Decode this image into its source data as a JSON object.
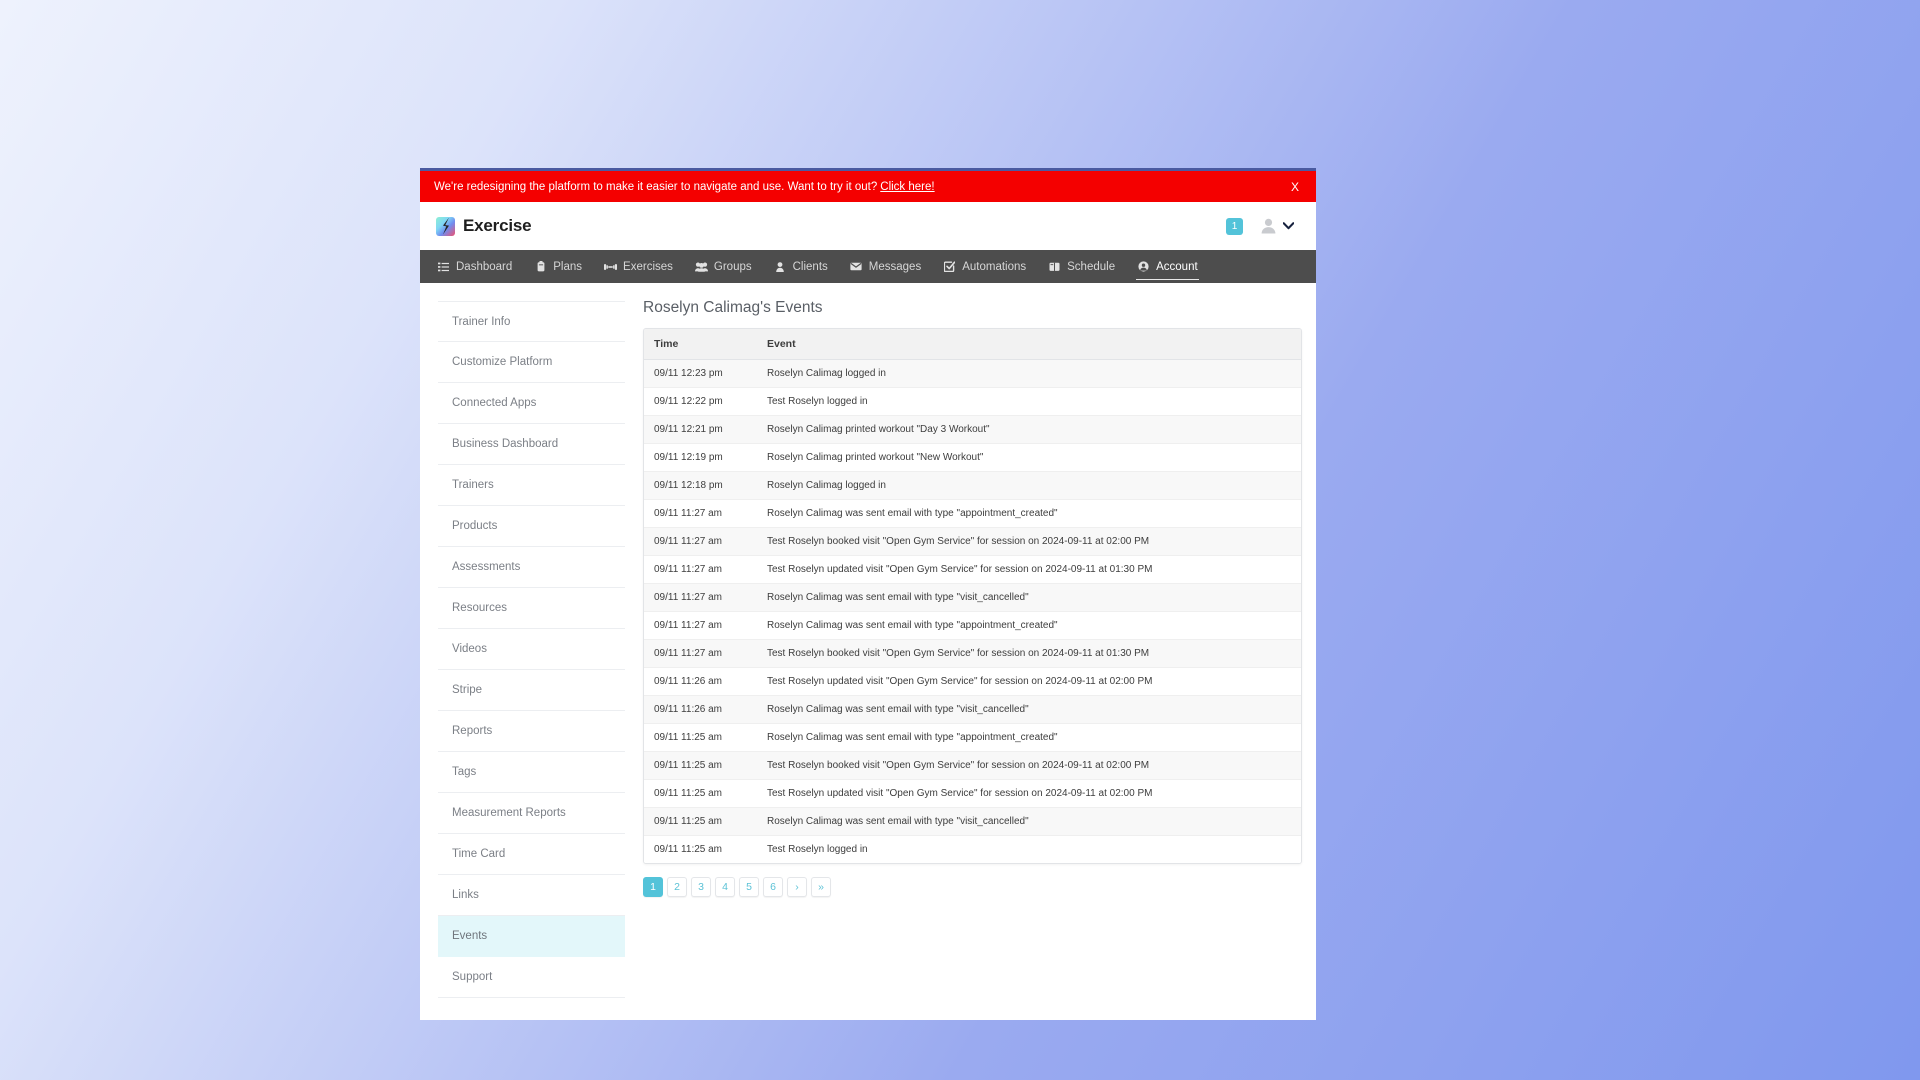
{
  "banner": {
    "message": "We're redesigning the platform to make it easier to navigate and use. Want to try it out?",
    "cta": "Click here!",
    "close": "X",
    "bg_color": "#f40000"
  },
  "header": {
    "brand": "Exercise",
    "badge_count": "1"
  },
  "nav": {
    "items": [
      {
        "label": "Dashboard",
        "icon": "list-icon",
        "active": false
      },
      {
        "label": "Plans",
        "icon": "clipboard-icon",
        "active": false
      },
      {
        "label": "Exercises",
        "icon": "dumbbell-icon",
        "active": false
      },
      {
        "label": "Groups",
        "icon": "group-icon",
        "active": false
      },
      {
        "label": "Clients",
        "icon": "person-icon",
        "active": false
      },
      {
        "label": "Messages",
        "icon": "envelope-icon",
        "active": false
      },
      {
        "label": "Automations",
        "icon": "check-square-icon",
        "active": false
      },
      {
        "label": "Schedule",
        "icon": "book-icon",
        "active": false
      },
      {
        "label": "Account",
        "icon": "user-circle-icon",
        "active": true
      }
    ],
    "active_color": "#ffffff",
    "bg_color": "#4d4d4d"
  },
  "sidebar": {
    "items": [
      {
        "label": "Trainer Info",
        "active": false
      },
      {
        "label": "Customize Platform",
        "active": false
      },
      {
        "label": "Connected Apps",
        "active": false
      },
      {
        "label": "Business Dashboard",
        "active": false
      },
      {
        "label": "Trainers",
        "active": false
      },
      {
        "label": "Products",
        "active": false
      },
      {
        "label": "Assessments",
        "active": false
      },
      {
        "label": "Resources",
        "active": false
      },
      {
        "label": "Videos",
        "active": false
      },
      {
        "label": "Stripe",
        "active": false
      },
      {
        "label": "Reports",
        "active": false
      },
      {
        "label": "Tags",
        "active": false
      },
      {
        "label": "Measurement Reports",
        "active": false
      },
      {
        "label": "Time Card",
        "active": false
      },
      {
        "label": "Links",
        "active": false
      },
      {
        "label": "Events",
        "active": true
      },
      {
        "label": "Support",
        "active": false
      }
    ],
    "active_bg": "#e3f7fa"
  },
  "main": {
    "title": "Roselyn Calimag's Events",
    "table": {
      "columns": [
        "Time",
        "Event"
      ],
      "rows": [
        [
          "09/11 12:23 pm",
          "Roselyn Calimag logged in"
        ],
        [
          "09/11 12:22 pm",
          "Test Roselyn logged in"
        ],
        [
          "09/11 12:21 pm",
          "Roselyn Calimag printed workout \"Day 3 Workout\""
        ],
        [
          "09/11 12:19 pm",
          "Roselyn Calimag printed workout \"New Workout\""
        ],
        [
          "09/11 12:18 pm",
          "Roselyn Calimag logged in"
        ],
        [
          "09/11 11:27 am",
          "Roselyn Calimag was sent email with type \"appointment_created\""
        ],
        [
          "09/11 11:27 am",
          "Test Roselyn booked visit \"Open Gym Service\" for session on 2024-09-11 at 02:00 PM"
        ],
        [
          "09/11 11:27 am",
          "Test Roselyn updated visit \"Open Gym Service\" for session on 2024-09-11 at 01:30 PM"
        ],
        [
          "09/11 11:27 am",
          "Roselyn Calimag was sent email with type \"visit_cancelled\""
        ],
        [
          "09/11 11:27 am",
          "Roselyn Calimag was sent email with type \"appointment_created\""
        ],
        [
          "09/11 11:27 am",
          "Test Roselyn booked visit \"Open Gym Service\" for session on 2024-09-11 at 01:30 PM"
        ],
        [
          "09/11 11:26 am",
          "Test Roselyn updated visit \"Open Gym Service\" for session on 2024-09-11 at 02:00 PM"
        ],
        [
          "09/11 11:26 am",
          "Roselyn Calimag was sent email with type \"visit_cancelled\""
        ],
        [
          "09/11 11:25 am",
          "Roselyn Calimag was sent email with type \"appointment_created\""
        ],
        [
          "09/11 11:25 am",
          "Test Roselyn booked visit \"Open Gym Service\" for session on 2024-09-11 at 02:00 PM"
        ],
        [
          "09/11 11:25 am",
          "Test Roselyn updated visit \"Open Gym Service\" for session on 2024-09-11 at 02:00 PM"
        ],
        [
          "09/11 11:25 am",
          "Roselyn Calimag was sent email with type \"visit_cancelled\""
        ],
        [
          "09/11 11:25 am",
          "Test Roselyn logged in"
        ]
      ]
    },
    "pagination": {
      "pages": [
        "1",
        "2",
        "3",
        "4",
        "5",
        "6"
      ],
      "next": "›",
      "last": "»",
      "active_page": "1",
      "active_color": "#53c3d9"
    }
  }
}
